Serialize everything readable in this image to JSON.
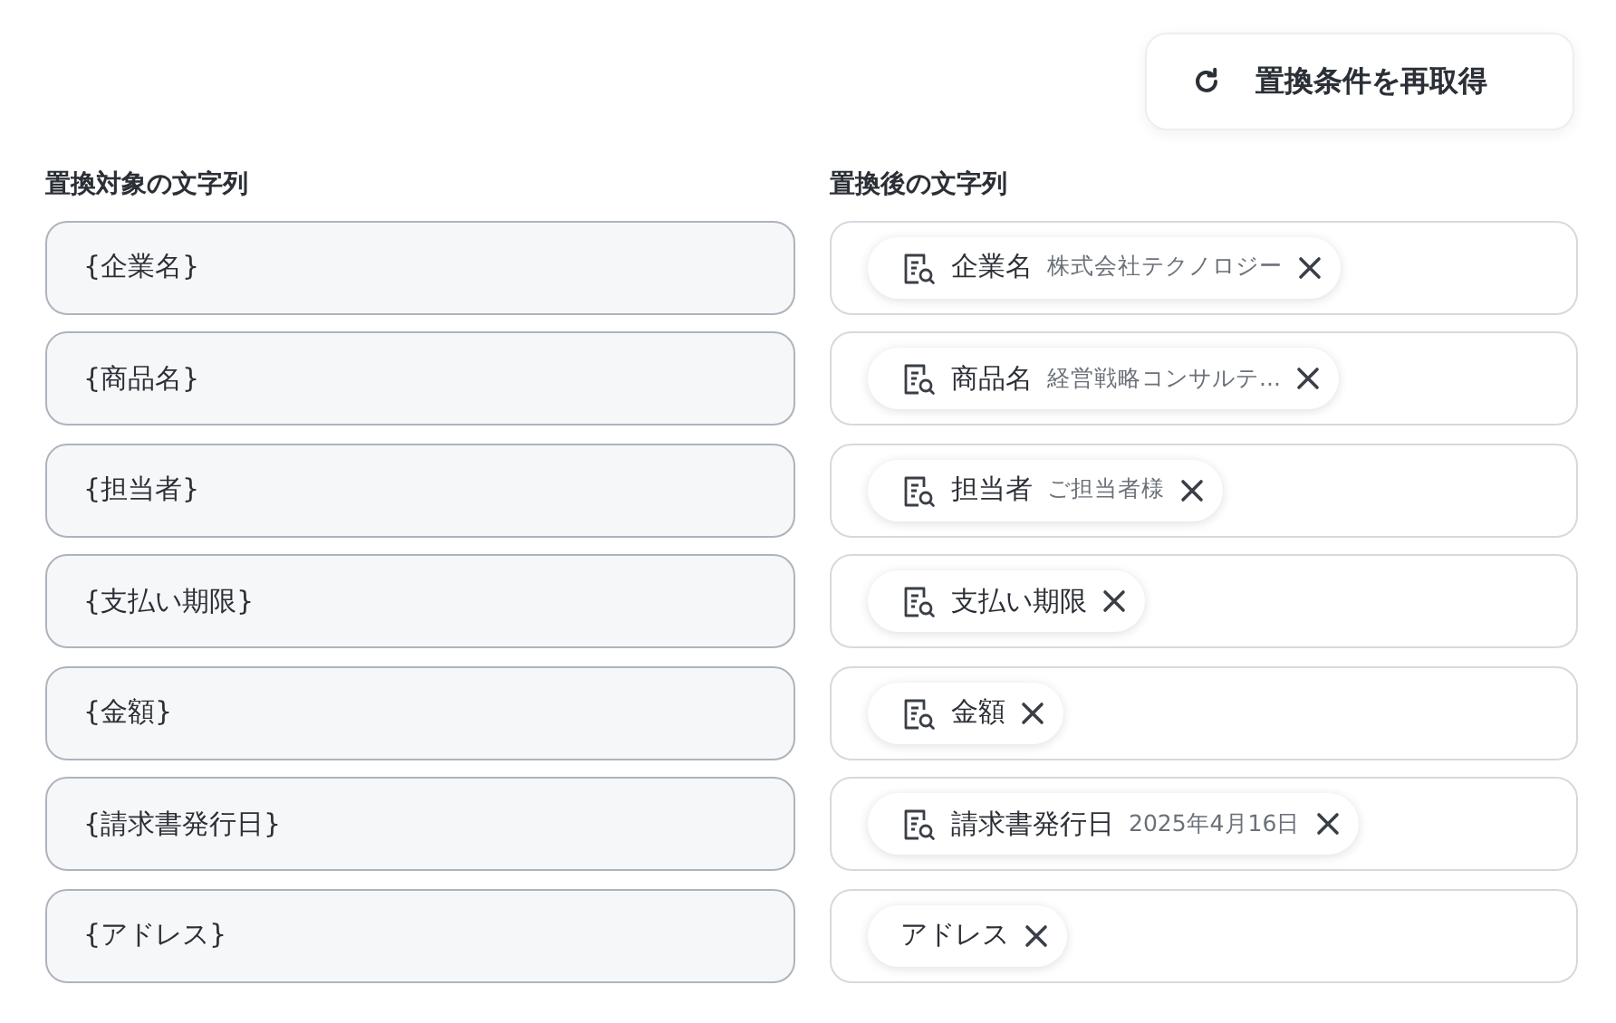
{
  "refresh_button": {
    "label": "置換条件を再取得"
  },
  "columns": {
    "source": "置換対象の文字列",
    "target": "置換後の文字列"
  },
  "rows": [
    {
      "source": "{企業名}",
      "chip": {
        "kind": "field",
        "label": "企業名",
        "value": "株式会社テクノロジー"
      }
    },
    {
      "source": "{商品名}",
      "chip": {
        "kind": "field",
        "label": "商品名",
        "value": "経営戦略コンサルテ..."
      }
    },
    {
      "source": "{担当者}",
      "chip": {
        "kind": "field",
        "label": "担当者",
        "value": "ご担当者様"
      }
    },
    {
      "source": "{支払い期限}",
      "chip": {
        "kind": "field",
        "label": "支払い期限"
      }
    },
    {
      "source": "{金額}",
      "chip": {
        "kind": "field",
        "label": "金額"
      }
    },
    {
      "source": "{請求書発行日}",
      "chip": {
        "kind": "field",
        "label": "請求書発行日",
        "value": "2025年4月16日"
      }
    },
    {
      "source": "{アドレス}",
      "chip": {
        "kind": "text",
        "label": "アドレス"
      }
    }
  ]
}
